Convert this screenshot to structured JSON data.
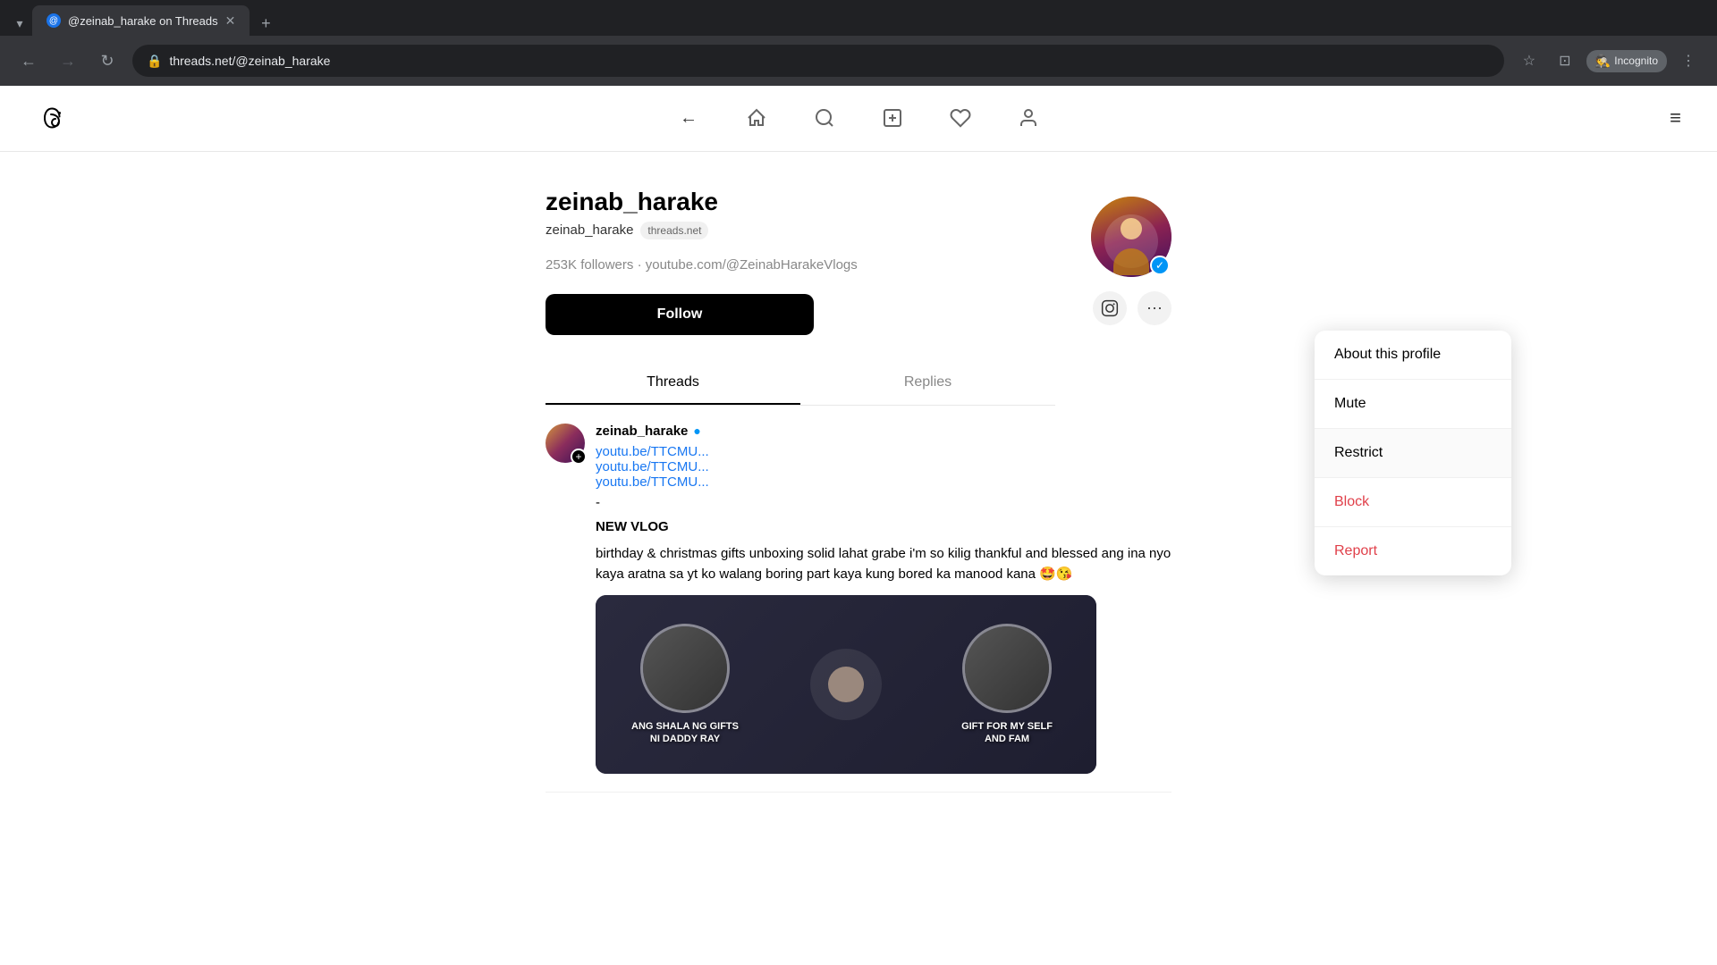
{
  "browser": {
    "tab": {
      "favicon": "@",
      "title": "@zeinab_harake on Threads",
      "close_icon": "✕"
    },
    "new_tab_icon": "+",
    "nav": {
      "back_icon": "←",
      "forward_icon": "→",
      "reload_icon": "↻",
      "url": "threads.net/@zeinab_harake",
      "bookmark_icon": "☆",
      "profile_icon": "⊡",
      "incognito_label": "Incognito",
      "incognito_icon": "🕵",
      "more_icon": "⋮"
    }
  },
  "threads_nav": {
    "back_icon": "←",
    "home_icon": "⌂",
    "search_icon": "🔍",
    "compose_icon": "✏",
    "heart_icon": "♡",
    "profile_icon": "👤",
    "menu_icon": "≡"
  },
  "profile": {
    "username": "zeinab_harake",
    "handle": "zeinab_harake",
    "domain_badge": "threads.net",
    "followers": "253K followers",
    "separator": "·",
    "youtube": "youtube.com/@ZeinabHarakeVlogs",
    "follow_label": "Follow",
    "tabs": [
      {
        "label": "Threads",
        "active": true
      },
      {
        "label": "Replies",
        "active": false
      }
    ],
    "verified": true,
    "social_links": {
      "instagram_icon": "📷",
      "more_icon": "⋯"
    }
  },
  "dropdown": {
    "items": [
      {
        "label": "About this profile",
        "danger": false
      },
      {
        "label": "Mute",
        "danger": false
      },
      {
        "label": "Restrict",
        "danger": false,
        "hovered": true
      },
      {
        "label": "Block",
        "danger": true
      },
      {
        "label": "Report",
        "danger": true
      }
    ]
  },
  "post": {
    "username": "zeinab_harake",
    "verified": true,
    "links": [
      "youtu.be/TTCMU...",
      "youtu.be/TTCMU...",
      "youtu.be/TTCMU..."
    ],
    "separator": "-",
    "title": "NEW VLOG",
    "body": "birthday & christmas gifts unboxing solid lahat grabe i'm so kilig thankful and blessed ang ina nyo kaya aratna sa yt ko walang boring part kaya kung bored ka manood kana 🤩😘",
    "image_labels": [
      "ANG SHALA NG GIFTS NI DADDY RAY",
      "GIFT FOR MY SELF AND FAM"
    ]
  }
}
